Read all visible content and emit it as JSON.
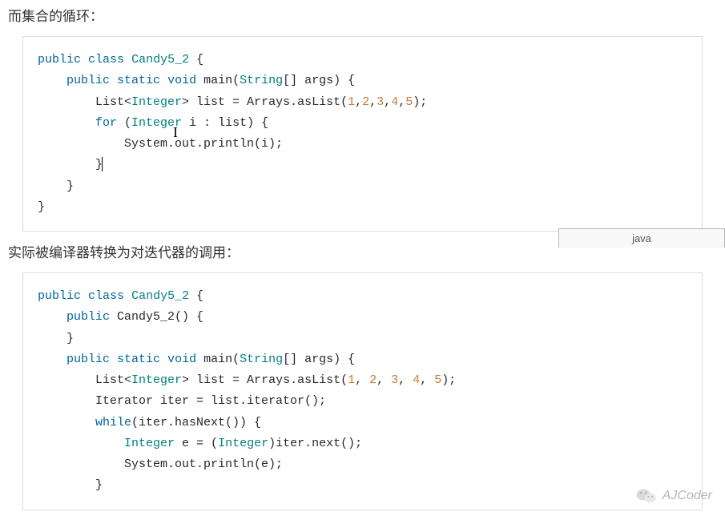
{
  "heading1": "而集合的循环：",
  "heading2": "实际被编译器转换为对迭代器的调用：",
  "lang_label": "java",
  "watermark_text": "AJCoder",
  "code1": {
    "kw_public": "public",
    "kw_class": "class",
    "cls_name": "Candy5_2",
    "l1_open": " {",
    "l2_pub": "public",
    "l2_static": "static",
    "l2_void": "void",
    "l2_main": " main(",
    "l2_string": "String",
    "l2_args": "[] args) {",
    "l3_list": "        List<",
    "l3_int": "Integer",
    "l3_rest": "> list = Arrays.asList(",
    "l3_n1": "1",
    "l3_n2": "2",
    "l3_n3": "3",
    "l3_n4": "4",
    "l3_n5": "5",
    "l3_end": ");",
    "l4_for": "for",
    "l4_open": " (",
    "l4_int": "Integer",
    "l4_rest": " i : list) {",
    "l5": "            System.out.println(i);",
    "l6": "        }",
    "l7": "    }",
    "l8": "}"
  },
  "code2": {
    "kw_public": "public",
    "kw_class": "class",
    "cls_name": "Candy5_2",
    "l1_open": " {",
    "l2_pub": "public",
    "l2_ctor": " Candy5_2() {",
    "l3": "    }",
    "l4_pub": "public",
    "l4_static": "static",
    "l4_void": "void",
    "l4_main": " main(",
    "l4_string": "String",
    "l4_args": "[] args) {",
    "l5_list": "        List<",
    "l5_int": "Integer",
    "l5_rest": "> list = Arrays.asList(",
    "l5_n1": "1",
    "l5_n2": "2",
    "l5_n3": "3",
    "l5_n4": "4",
    "l5_n5": "5",
    "l5_end": ");",
    "l6": "        Iterator iter = list.iterator();",
    "l7_while": "while",
    "l7_rest": "(iter.hasNext()) {",
    "l8_a": "            ",
    "l8_int": "Integer",
    "l8_b": " e = (",
    "l8_int2": "Integer",
    "l8_c": ")iter.next();",
    "l9": "            System.out.println(e);",
    "l10": "        }"
  }
}
